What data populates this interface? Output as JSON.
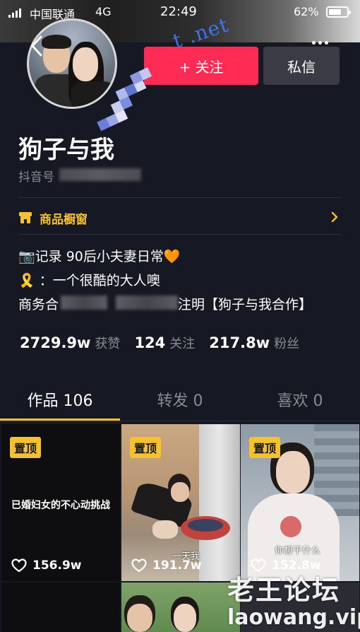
{
  "status_bar": {
    "carrier": "中国联通",
    "network": "4G",
    "time": "22:49",
    "battery": "62%"
  },
  "profile": {
    "follow_label": "+ 关注",
    "message_label": "私信",
    "nickname": "狗子与我",
    "douyin_id_prefix": "抖音号"
  },
  "shop": {
    "label": "商品橱窗"
  },
  "bio": {
    "line1": "📷记录 90后小夫妻日常🧡",
    "line2": "🎗️ ：一个很酷的大人噢",
    "line3_start": "商务合",
    "line3_end": "注明【狗子与我合作】"
  },
  "stats": {
    "likes_value": "2729.9w",
    "likes_label": "获赞",
    "following_value": "124",
    "following_label": "关注",
    "followers_value": "217.8w",
    "followers_label": "粉丝"
  },
  "tabs": [
    {
      "label": "作品 106"
    },
    {
      "label": "转发 0"
    },
    {
      "label": "喜欢 0"
    }
  ],
  "videos": [
    {
      "badge": "置顶",
      "title": "已婚妇女的不心动挑战",
      "likes": "156.9w"
    },
    {
      "badge": "置顶",
      "caption": "一天我",
      "likes": "191.7w"
    },
    {
      "badge": "置顶",
      "caption": "你想干什么",
      "likes": "152.8w"
    }
  ],
  "watermark": {
    "overlay_text": "t .net",
    "site_cn": "老王论坛",
    "site_url": "laowang.vip"
  },
  "colors": {
    "background": "#161823",
    "follow": "#fe2c55",
    "accent_yellow": "#f5c12e",
    "muted_text": "#8a8b91"
  }
}
